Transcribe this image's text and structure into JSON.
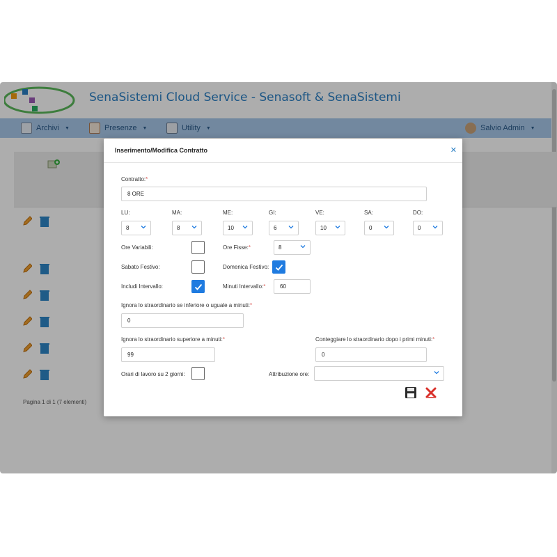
{
  "app": {
    "title": "SenaSistemi Cloud Service - Senasoft & SenaSistemi",
    "user": "Salvio Admin"
  },
  "nav": {
    "items": [
      {
        "label": "Archivi"
      },
      {
        "label": "Presenze"
      },
      {
        "label": "Utility"
      }
    ]
  },
  "background": {
    "pager": "Pagina 1 di 1 (7 elementi)"
  },
  "modal": {
    "title": "Inserimento/Modifica Contratto",
    "contratto": {
      "label": "Contratto:",
      "value": "8 ORE"
    },
    "days": [
      {
        "label": "LU:",
        "value": "8"
      },
      {
        "label": "MA:",
        "value": "8"
      },
      {
        "label": "ME:",
        "value": "10"
      },
      {
        "label": "GI:",
        "value": "6"
      },
      {
        "label": "VE:",
        "value": "10"
      },
      {
        "label": "SA:",
        "value": "0"
      },
      {
        "label": "DO:",
        "value": "0"
      }
    ],
    "ore_variabili": {
      "label": "Ore Variabili:",
      "checked": false
    },
    "ore_fisse": {
      "label": "Ore Fisse:",
      "value": "8"
    },
    "sabato_festivo": {
      "label": "Sabato Festivo:",
      "checked": false
    },
    "domenica_festivo": {
      "label": "Domenica Festivo:",
      "checked": true
    },
    "includi_intervallo": {
      "label": "Includi Intervallo:",
      "checked": true
    },
    "minuti_intervallo": {
      "label": "Minuti Intervallo:",
      "value": "60"
    },
    "ignora_inferiore": {
      "label": "Ignora lo straordinario se inferiore o uguale a minuti:",
      "value": "0"
    },
    "ignora_superiore": {
      "label": "Ignora lo straordinario superiore a minuti:",
      "value": "99"
    },
    "conteggiare": {
      "label": "Conteggiare lo straordinario dopo i primi minuti:",
      "value": "0"
    },
    "orari_due_giorni": {
      "label": "Orari di lavoro su 2 giorni:",
      "checked": false
    },
    "attribuzione": {
      "label": "Attribuzione ore:",
      "value": ""
    },
    "required_mark": "*"
  },
  "colors": {
    "accent": "#1f7be0",
    "brand": "#2a7fc4",
    "navbar": "#a9c9ea",
    "required": "#d9534f"
  }
}
